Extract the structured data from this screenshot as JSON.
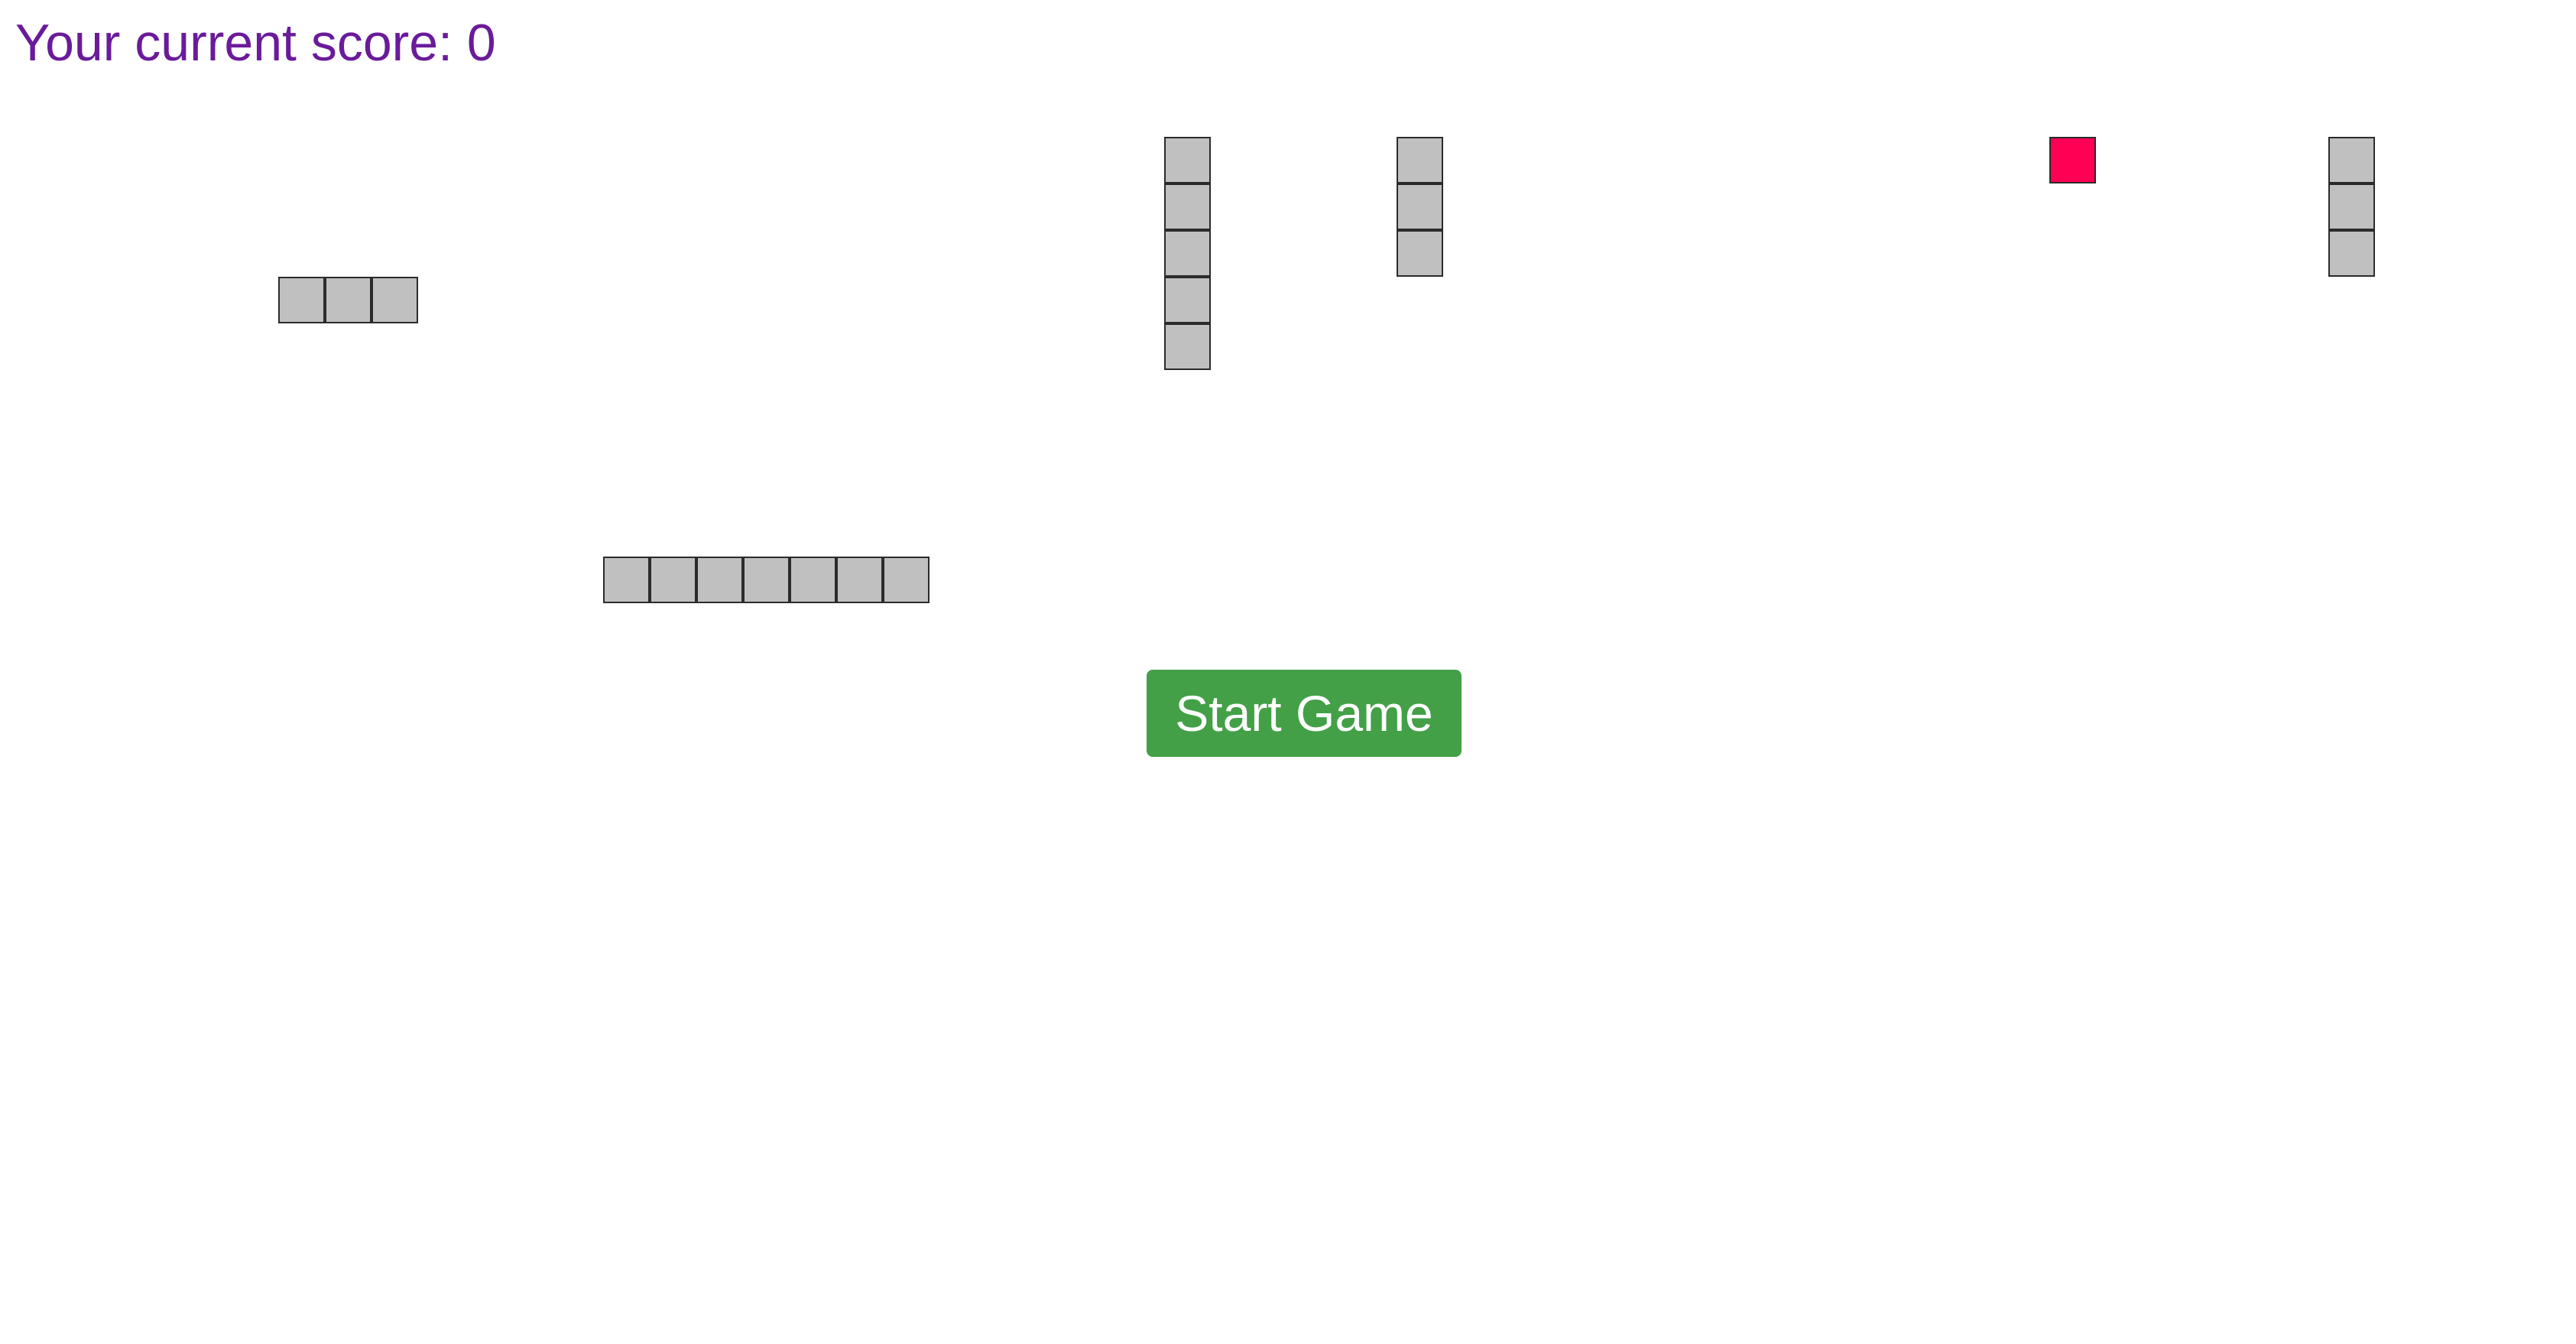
{
  "score": {
    "text": "Your current score: 0",
    "color": "#6a1b9a"
  },
  "start_button": {
    "label": "Start Game",
    "color": "#43a047"
  },
  "board": {
    "cell_color": "#c0c0c0",
    "food_color": "#ff0055",
    "objects": [
      {
        "name": "segment-horizontal-3",
        "kind": "segment",
        "orientation": "horizontal",
        "cells": 3
      },
      {
        "name": "segment-horizontal-7",
        "kind": "segment",
        "orientation": "horizontal",
        "cells": 7
      },
      {
        "name": "segment-vertical-5",
        "kind": "segment",
        "orientation": "vertical",
        "cells": 5
      },
      {
        "name": "segment-vertical-3-a",
        "kind": "segment",
        "orientation": "vertical",
        "cells": 3
      },
      {
        "name": "food-block",
        "kind": "food",
        "orientation": "single",
        "cells": 1
      },
      {
        "name": "segment-vertical-3-b",
        "kind": "segment",
        "orientation": "vertical",
        "cells": 3
      }
    ]
  }
}
